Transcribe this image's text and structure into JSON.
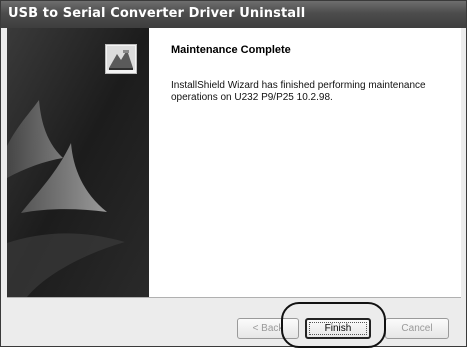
{
  "window": {
    "title": "USB to Serial Converter Driver Uninstall"
  },
  "content": {
    "heading": "Maintenance Complete",
    "message": "InstallShield Wizard has finished performing maintenance operations on U232 P9/P25 10.2.98."
  },
  "buttons": {
    "back_label": "< Back",
    "finish_label": "Finish",
    "cancel_label": "Cancel"
  },
  "icons": {
    "wizard": "installshield-wizard-icon"
  },
  "colors": {
    "titlebar": "#4c4c4c",
    "left_panel": "#202020",
    "content_background": "#ffffff"
  }
}
